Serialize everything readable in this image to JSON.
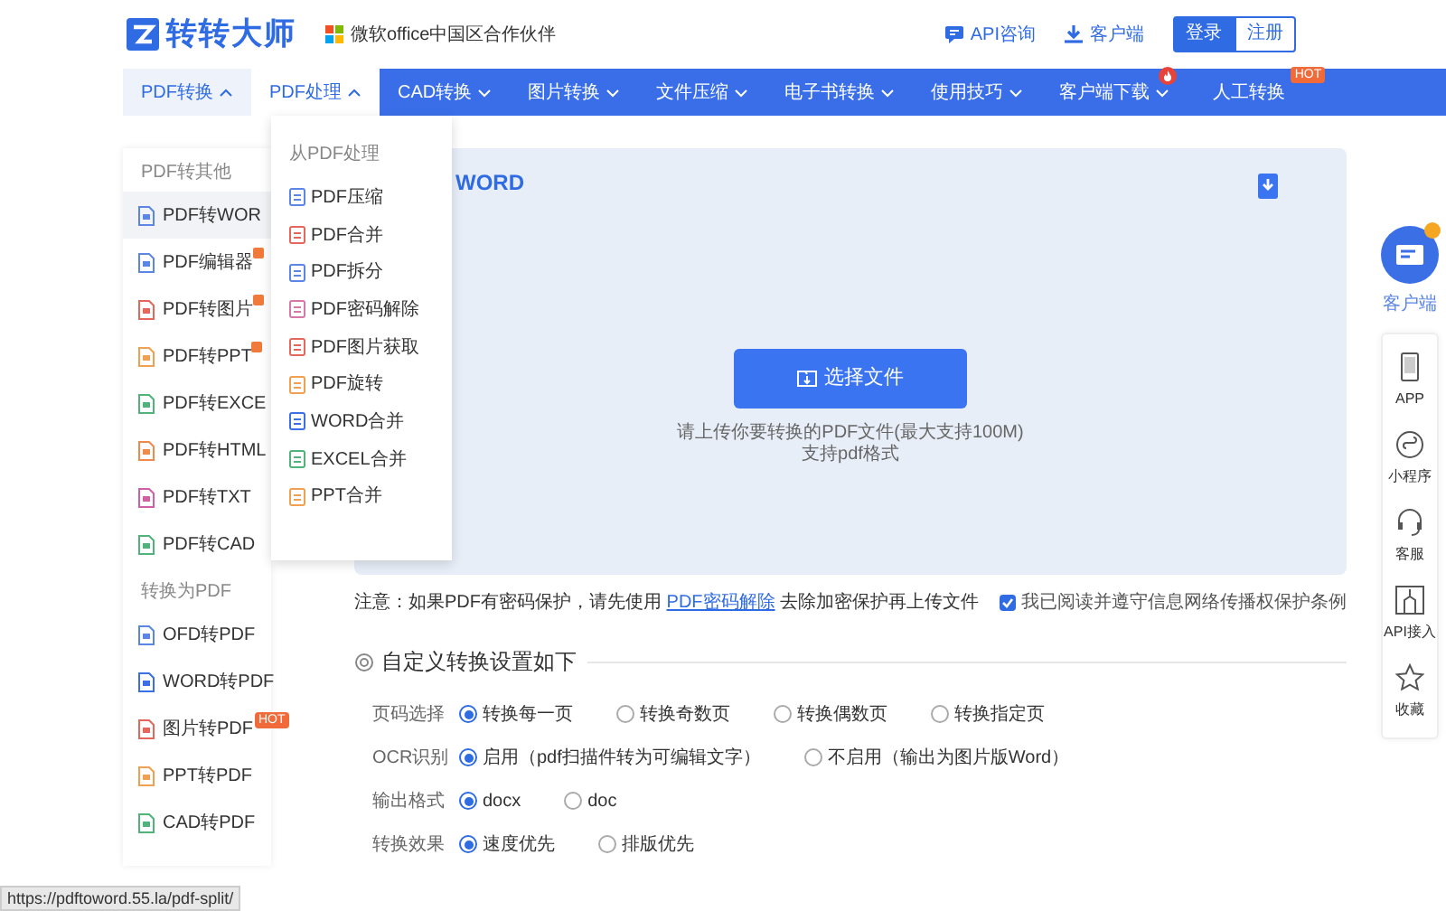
{
  "header": {
    "logo_text": "转转大师",
    "partner": "微软office中国区合作伙伴",
    "links": [
      {
        "label": "API咨询",
        "kind": "chat"
      },
      {
        "label": "客户端",
        "kind": "download"
      }
    ],
    "auth_buttons": [
      {
        "label": "登录",
        "selected": true
      },
      {
        "label": "注册",
        "selected": false
      }
    ]
  },
  "nav": {
    "items": [
      {
        "label": "PDF转换",
        "selected": true,
        "expanded": false,
        "caret": true
      },
      {
        "label": "PDF处理",
        "selected": false,
        "expanded": true,
        "caret": true
      },
      {
        "label": "CAD转换",
        "selected": false,
        "expanded": false,
        "caret": true
      },
      {
        "label": "图片转换",
        "selected": false,
        "expanded": false,
        "caret": true
      },
      {
        "label": "文件压缩",
        "selected": false,
        "expanded": false,
        "caret": true
      },
      {
        "label": "电子书转换",
        "selected": false,
        "expanded": false,
        "caret": true
      },
      {
        "label": "使用技巧",
        "selected": false,
        "expanded": false,
        "caret": true
      },
      {
        "label": "客户端下载",
        "selected": false,
        "expanded": false,
        "caret": true,
        "fire": true
      },
      {
        "label": "人工转换",
        "selected": false,
        "expanded": false,
        "caret": false,
        "badge": "HOT"
      }
    ]
  },
  "sidebar": {
    "groups": [
      {
        "heading": "PDF转其他",
        "items": [
          {
            "label": "PDF转WOR",
            "color": "#5b86e5",
            "selected": true
          },
          {
            "label": "PDF编辑器",
            "color": "#5b86e5",
            "selected": false,
            "flag": true
          },
          {
            "label": "PDF转图片",
            "color": "#e5675b",
            "selected": false,
            "flag": true
          },
          {
            "label": "PDF转PPT",
            "color": "#f0a050",
            "selected": false,
            "flag": true
          },
          {
            "label": "PDF转EXCE",
            "color": "#4fb37a",
            "selected": false
          },
          {
            "label": "PDF转HTML",
            "color": "#f08a4b",
            "selected": false
          },
          {
            "label": "PDF转TXT",
            "color": "#d05fa8",
            "selected": false
          },
          {
            "label": "PDF转CAD",
            "color": "#4fb37a",
            "selected": false
          }
        ]
      },
      {
        "heading": "转换为PDF",
        "items": [
          {
            "label": "OFD转PDF",
            "color": "#5b86e5",
            "selected": false
          },
          {
            "label": "WORD转PDF",
            "color": "#3b6fe6",
            "selected": false
          },
          {
            "label": "图片转PDF",
            "color": "#e5675b",
            "selected": false,
            "badge": "HOT"
          },
          {
            "label": "PPT转PDF",
            "color": "#f0a050",
            "selected": false
          },
          {
            "label": "CAD转PDF",
            "color": "#4fb37a",
            "selected": false
          }
        ]
      }
    ]
  },
  "dropdown": {
    "heading": "从PDF处理",
    "items": [
      {
        "label": "PDF压缩",
        "color": "#5b86e5"
      },
      {
        "label": "PDF合并",
        "color": "#e5675b"
      },
      {
        "label": "PDF拆分",
        "color": "#5b86e5"
      },
      {
        "label": "PDF密码解除",
        "color": "#d878a8"
      },
      {
        "label": "PDF图片获取",
        "color": "#e5675b"
      },
      {
        "label": "PDF旋转",
        "color": "#f0a050"
      },
      {
        "label": "WORD合并",
        "color": "#3b6fe6"
      },
      {
        "label": "EXCEL合并",
        "color": "#4fb37a"
      },
      {
        "label": "PPT合并",
        "color": "#f0a050"
      }
    ]
  },
  "upload": {
    "title": "WORD",
    "button": "选择文件",
    "hints": [
      "请上传你要转换的PDF文件(最大支持100M)",
      "支持pdf格式"
    ]
  },
  "notice": {
    "before": "注意：如果PDF有密码保护，请先使用 ",
    "link": "PDF密码解除",
    "after": " 去除加密保护再上传文件"
  },
  "agreement": {
    "label": "我已阅读并遵守信息网络传播权保护条例",
    "checked": true
  },
  "settings": {
    "title": "自定义转换设置如下",
    "rows": [
      {
        "label": "页码选择",
        "options": [
          {
            "label": "转换每一页",
            "selected": true
          },
          {
            "label": "转换奇数页",
            "selected": false
          },
          {
            "label": "转换偶数页",
            "selected": false
          },
          {
            "label": "转换指定页",
            "selected": false
          }
        ]
      },
      {
        "label": "OCR识别",
        "options": [
          {
            "label": "启用（pdf扫描件转为可编辑文字）",
            "selected": true
          },
          {
            "label": "不启用（输出为图片版Word）",
            "selected": false
          }
        ]
      },
      {
        "label": "输出格式",
        "options": [
          {
            "label": "docx",
            "selected": true
          },
          {
            "label": "doc",
            "selected": false
          }
        ]
      },
      {
        "label": "转换效果",
        "options": [
          {
            "label": "速度优先",
            "selected": true
          },
          {
            "label": "排版优先",
            "selected": false
          }
        ]
      }
    ]
  },
  "dock": {
    "client": {
      "label": "客户端"
    },
    "items": [
      {
        "label": "APP",
        "kind": "phone"
      },
      {
        "label": "小程序",
        "kind": "miniapp"
      },
      {
        "label": "客服",
        "kind": "headset"
      },
      {
        "label": "API接入",
        "kind": "api"
      },
      {
        "label": "收藏",
        "kind": "star"
      }
    ]
  },
  "status_bar": "https://pdftoword.55.la/pdf-split/"
}
